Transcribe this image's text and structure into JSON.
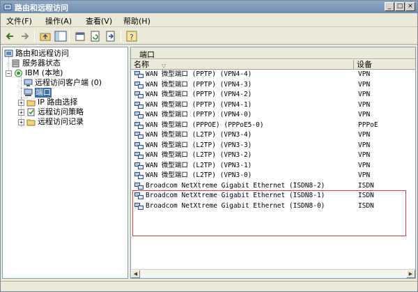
{
  "window": {
    "title": "路由和远程访问"
  },
  "menu": {
    "items": [
      "文件(F)",
      "操作(A)",
      "查看(V)",
      "帮助(H)"
    ]
  },
  "tree": {
    "root": "路由和远程访问",
    "server_status": "服务器状态",
    "server": "IBM (本地)",
    "children": [
      "远程访问客户端 (0)",
      "端口",
      "IP 路由选择",
      "远程访问策略",
      "远程访问记录"
    ]
  },
  "right_pane": {
    "title": "端口",
    "columns": [
      "名称",
      "设备"
    ],
    "rows": [
      {
        "name": "WAN 微型端口 (PPTP) (VPN4-4)",
        "device": "VPN"
      },
      {
        "name": "WAN 微型端口 (PPTP) (VPN4-3)",
        "device": "VPN"
      },
      {
        "name": "WAN 微型端口 (PPTP) (VPN4-2)",
        "device": "VPN"
      },
      {
        "name": "WAN 微型端口 (PPTP) (VPN4-1)",
        "device": "VPN"
      },
      {
        "name": "WAN 微型端口 (PPTP) (VPN4-0)",
        "device": "VPN"
      },
      {
        "name": "WAN 微型端口 (PPPOE) (PPPoE5-0)",
        "device": "PPPoE"
      },
      {
        "name": "WAN 微型端口 (L2TP) (VPN3-4)",
        "device": "VPN"
      },
      {
        "name": "WAN 微型端口 (L2TP) (VPN3-3)",
        "device": "VPN"
      },
      {
        "name": "WAN 微型端口 (L2TP) (VPN3-2)",
        "device": "VPN"
      },
      {
        "name": "WAN 微型端口 (L2TP) (VPN3-1)",
        "device": "VPN"
      },
      {
        "name": "WAN 微型端口 (L2TP) (VPN3-0)",
        "device": "VPN"
      },
      {
        "name": "Broadcom NetXtreme Gigabit Ethernet (ISDN8-2)",
        "device": "ISDN"
      },
      {
        "name": "Broadcom NetXtreme Gigabit Ethernet (ISDN8-1)",
        "device": "ISDN"
      },
      {
        "name": "Broadcom NetXtreme Gigabit Ethernet (ISDN8-0)",
        "device": "ISDN"
      }
    ]
  },
  "colors": {
    "highlight_box": "#c8463e",
    "selection": "#3a6ea5",
    "titlebar": "#7b97b9"
  }
}
